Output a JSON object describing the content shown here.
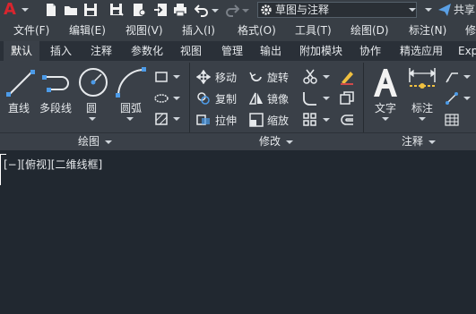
{
  "app": {
    "logo_letter": "A",
    "brand_color": "#d8252e"
  },
  "quick_access": {
    "workspace": "草图与注释",
    "share": "共享",
    "icons": [
      "new-file-icon",
      "open-folder-icon",
      "save-icon",
      "save-as-icon",
      "cloud-save-icon",
      "import-icon",
      "print-icon",
      "undo-icon",
      "redo-icon",
      "gear-icon",
      "share-icon"
    ]
  },
  "menu": [
    "文件(F)",
    "编辑(E)",
    "视图(V)",
    "插入(I)",
    "格式(O)",
    "工具(T)",
    "绘图(D)",
    "标注(N)",
    "修"
  ],
  "tabs": [
    "默认",
    "插入",
    "注释",
    "参数化",
    "视图",
    "管理",
    "输出",
    "附加模块",
    "协作",
    "精选应用",
    "Exp"
  ],
  "ribbon": {
    "draw": {
      "title": "绘图",
      "buttons": [
        "直线",
        "多段线",
        "圆",
        "圆弧"
      ]
    },
    "modify": {
      "title": "修改",
      "buttons": [
        "移动",
        "旋转",
        "复制",
        "镜像",
        "拉伸",
        "缩放"
      ]
    },
    "annotation": {
      "title": "注释",
      "buttons": [
        "文字",
        "标注"
      ]
    }
  },
  "viewport": {
    "label": "[−][俯视][二维线框]"
  }
}
